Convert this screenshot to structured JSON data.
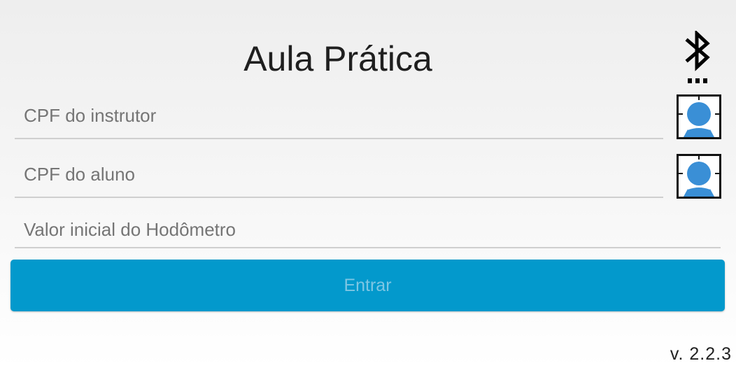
{
  "header": {
    "title": "Aula Prática"
  },
  "form": {
    "instructor_cpf": {
      "placeholder": "CPF do instrutor",
      "value": ""
    },
    "student_cpf": {
      "placeholder": "CPF do aluno",
      "value": ""
    },
    "odometer": {
      "placeholder": "Valor inicial do Hodômetro",
      "value": ""
    },
    "submit_label": "Entrar"
  },
  "icons": {
    "bluetooth": "bluetooth-icon",
    "biometric": "fingerprint-scan-icon"
  },
  "colors": {
    "primary_button": "#0399cc",
    "button_text": "#7ec6e3",
    "biometric_accent": "#3a8fd6"
  },
  "footer": {
    "version": "v. 2.2.3"
  }
}
